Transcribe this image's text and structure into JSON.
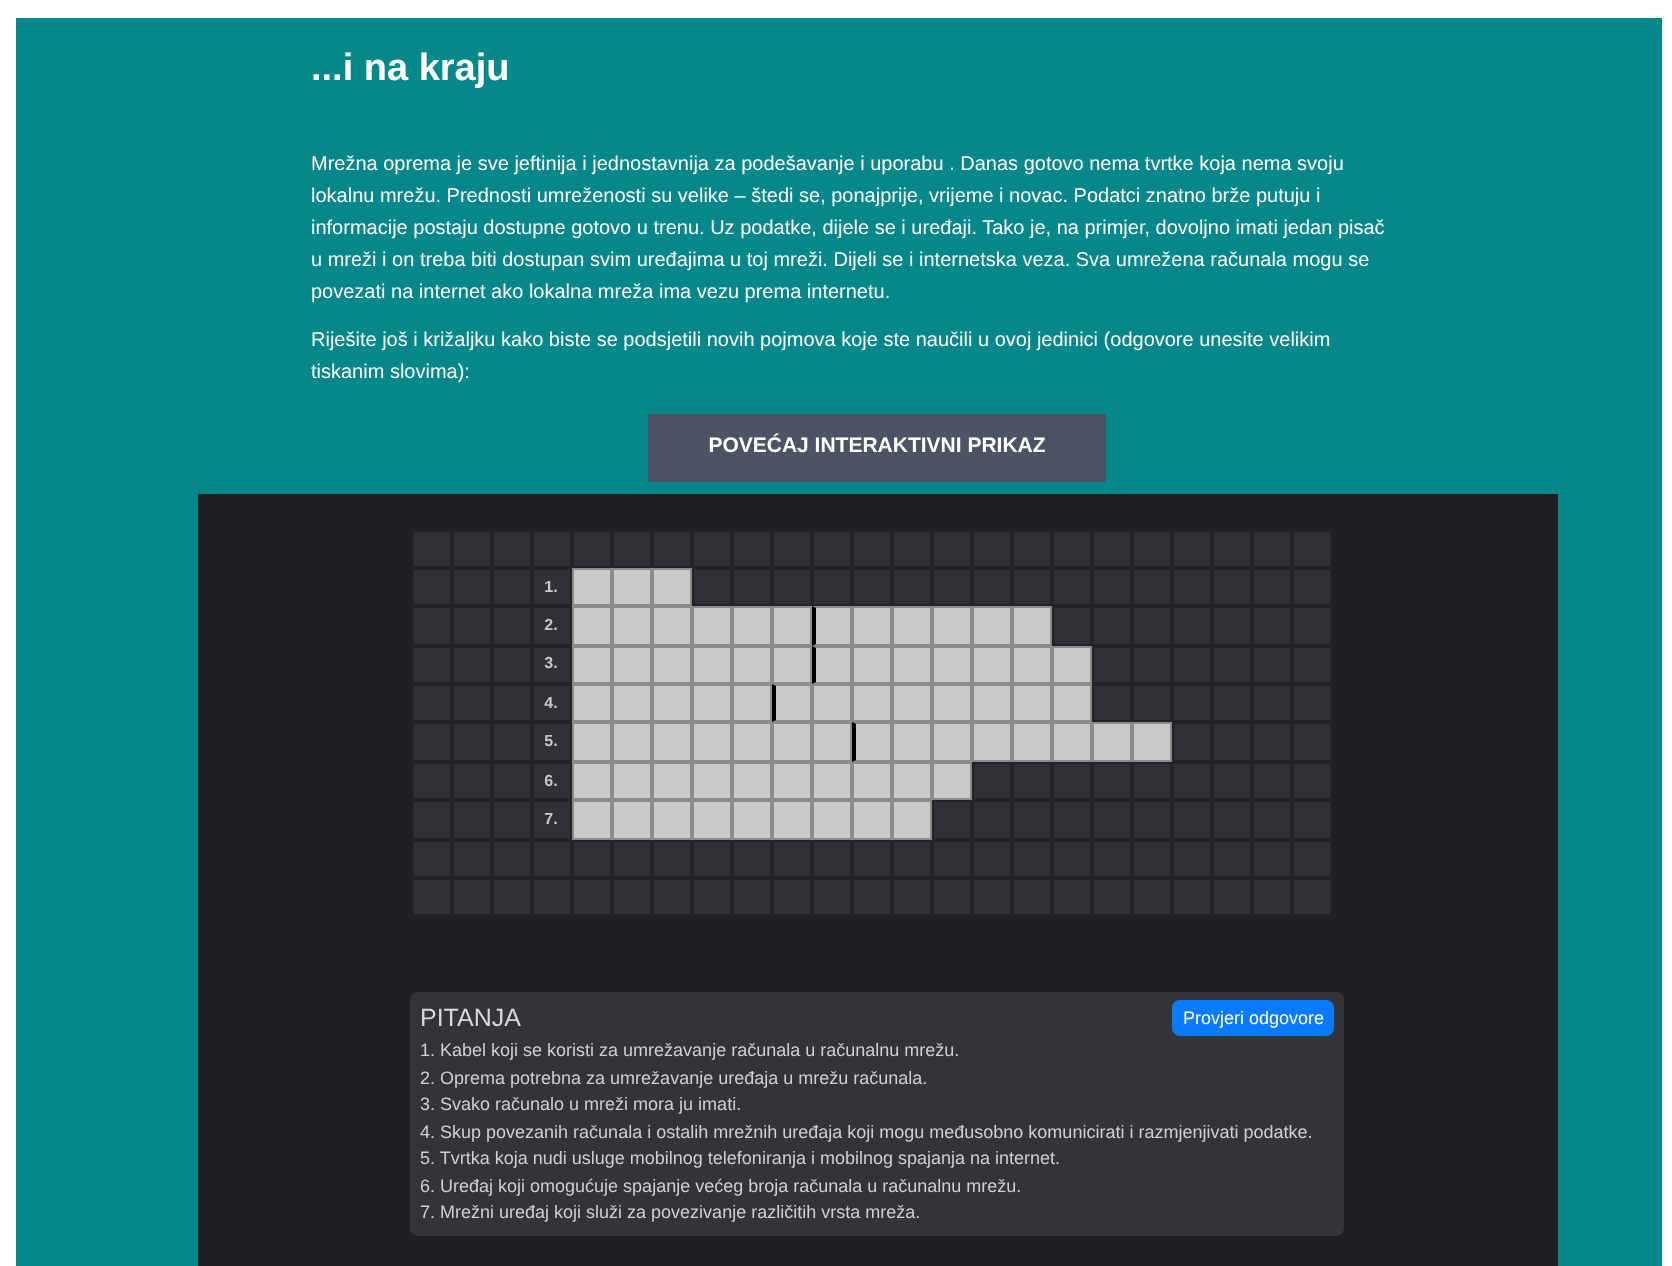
{
  "heading": "...i na kraju",
  "paragraphs": [
    "Mrežna oprema je sve jeftinija i jednostavnija za podešavanje i uporabu . Danas gotovo nema tvrtke koja nema svoju lokalnu mrežu. Prednosti umreženosti su velike – štedi se, ponajprije, vrijeme i novac. Podatci znatno brže putuju i informacije postaju dostupne gotovo u trenu. Uz podatke, dijele se i uređaji. Tako je, na primjer, dovoljno imati jedan pisač u mreži i on treba biti dostupan svim uređajima u toj mreži. Dijeli se i internetska veza. Sva umrežena računala mogu se povezati na internet ako lokalna mreža ima vezu prema internetu.",
    "Riješite još i križaljku kako biste se podsjetili novih pojmova koje ste naučili u ovoj jedinici (odgovore unesite velikim tiskanim slovima):"
  ],
  "enlarge_button": "POVEĆAJ INTERAKTIVNI PRIKAZ",
  "crossword": {
    "rows": [
      {
        "kind": "blank"
      },
      {
        "kind": "entry",
        "label": "1.",
        "cells": [
          {
            "marked": false
          },
          {
            "marked": false
          },
          {
            "marked": false
          }
        ]
      },
      {
        "kind": "entry",
        "label": "2.",
        "cells": [
          {
            "marked": false
          },
          {
            "marked": false
          },
          {
            "marked": false
          },
          {
            "marked": false
          },
          {
            "marked": false
          },
          {
            "marked": false
          },
          {
            "marked": true
          },
          {
            "marked": false
          },
          {
            "marked": false
          },
          {
            "marked": false
          },
          {
            "marked": false
          },
          {
            "marked": false
          }
        ]
      },
      {
        "kind": "entry",
        "label": "3.",
        "cells": [
          {
            "marked": false
          },
          {
            "marked": false
          },
          {
            "marked": false
          },
          {
            "marked": false
          },
          {
            "marked": false
          },
          {
            "marked": false
          },
          {
            "marked": true
          },
          {
            "marked": false
          },
          {
            "marked": false
          },
          {
            "marked": false
          },
          {
            "marked": false
          },
          {
            "marked": false
          },
          {
            "marked": false
          }
        ]
      },
      {
        "kind": "entry",
        "label": "4.",
        "cells": [
          {
            "marked": false
          },
          {
            "marked": false
          },
          {
            "marked": false
          },
          {
            "marked": false
          },
          {
            "marked": false
          },
          {
            "marked": true
          },
          {
            "marked": false
          },
          {
            "marked": false
          },
          {
            "marked": false
          },
          {
            "marked": false
          },
          {
            "marked": false
          },
          {
            "marked": false
          },
          {
            "marked": false
          }
        ]
      },
      {
        "kind": "entry",
        "label": "5.",
        "cells": [
          {
            "marked": false
          },
          {
            "marked": false
          },
          {
            "marked": false
          },
          {
            "marked": false
          },
          {
            "marked": false
          },
          {
            "marked": false
          },
          {
            "marked": false
          },
          {
            "marked": true
          },
          {
            "marked": false
          },
          {
            "marked": false
          },
          {
            "marked": false
          },
          {
            "marked": false
          },
          {
            "marked": false
          },
          {
            "marked": false
          },
          {
            "marked": false
          }
        ]
      },
      {
        "kind": "entry",
        "label": "6.",
        "cells": [
          {
            "marked": false
          },
          {
            "marked": false
          },
          {
            "marked": false
          },
          {
            "marked": false
          },
          {
            "marked": false
          },
          {
            "marked": false
          },
          {
            "marked": false
          },
          {
            "marked": false
          },
          {
            "marked": false
          },
          {
            "marked": false
          }
        ]
      },
      {
        "kind": "entry",
        "label": "7.",
        "cells": [
          {
            "marked": false
          },
          {
            "marked": false
          },
          {
            "marked": false
          },
          {
            "marked": false
          },
          {
            "marked": false
          },
          {
            "marked": false
          },
          {
            "marked": false
          },
          {
            "marked": false
          },
          {
            "marked": false
          }
        ]
      },
      {
        "kind": "blank"
      },
      {
        "kind": "blank"
      }
    ]
  },
  "questions": {
    "title": "PITANJA",
    "check_button": "Provjeri odgovore",
    "items": [
      "1. Kabel koji se koristi za umrežavanje računala u računalnu mrežu.",
      "2. Oprema potrebna za umrežavanje uređaja u mrežu računala.",
      "3. Svako računalo u mreži mora ju imati.",
      "4. Skup povezanih računala i ostalih mrežnih uređaja koji mogu međusobno komunicirati i razmjenjivati podatke.",
      "5. Tvrtka koja nudi usluge mobilnog telefoniranja i mobilnog spajanja na internet.",
      "6. Uređaj koji omogućuje spajanje većeg broja računala u računalnu mrežu.",
      "7. Mrežni uređaj koji služi za povezivanje različitih vrsta mreža."
    ]
  }
}
